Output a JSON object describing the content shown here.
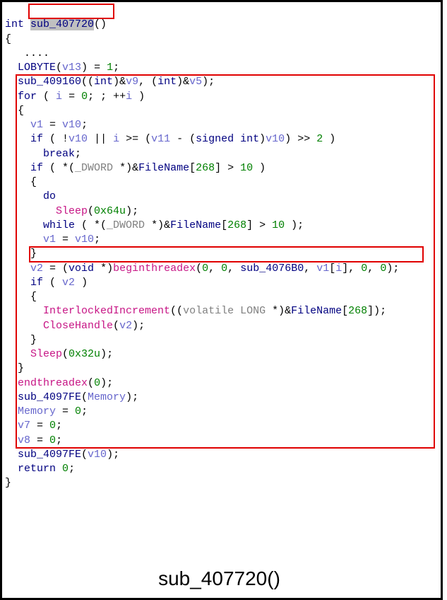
{
  "line1_int": "int",
  "line1_name": "sub_407720",
  "line1_paren": "()",
  "line2": "{",
  "line3_dots": "....",
  "line4_fn": "LOBYTE",
  "line4_v13": "v13",
  "line4_rest": ") = ",
  "line4_one": "1",
  "line4_semi": ";",
  "line5_fn": "sub_409160",
  "line5_int": "int",
  "line5_v9": "v9",
  "line5_v5": "v5",
  "line6_for": "for",
  "line6_i1": "i",
  "line6_zero": "0",
  "line6_i2": "i",
  "line7_brace": "{",
  "line8_v1": "v1",
  "line8_v10": "v10",
  "line9_if": "if",
  "line9_v10": "v10",
  "line9_i": "i",
  "line9_v11": "v11",
  "line9_signed": "signed int",
  "line9_v10b": "v10",
  "line9_two": "2",
  "line10_break": "break",
  "line11_if": "if",
  "line11_dword": "_DWORD",
  "line11_fn": "FileName",
  "line11_268": "268",
  "line11_ten": "10",
  "line12_brace": "{",
  "line13_do": "do",
  "line14_sleep": "Sleep",
  "line14_hex": "0x64u",
  "line15_while": "while",
  "line15_dword": "_DWORD",
  "line15_fn": "FileName",
  "line15_268": "268",
  "line15_ten": "10",
  "line16_v1": "v1",
  "line16_v10": "v10",
  "line17_brace": "}",
  "line18_v2": "v2",
  "line18_void": "void",
  "line18_begin": "beginthreadex",
  "line18_z1": "0",
  "line18_z2": "0",
  "line18_sub": "sub_4076B0",
  "line18_v1": "v1",
  "line18_i": "i",
  "line18_z3": "0",
  "line18_z4": "0",
  "line19_if": "if",
  "line19_v2": "v2",
  "line20_brace": "{",
  "line21_inc": "InterlockedIncrement",
  "line21_vol": "volatile",
  "line21_long": "LONG",
  "line21_fn": "FileName",
  "line21_268": "268",
  "line22_close": "CloseHandle",
  "line22_v2": "v2",
  "line23_brace": "}",
  "line24_sleep": "Sleep",
  "line24_hex": "0x32u",
  "line25_brace": "}",
  "line26_end": "endthreadex",
  "line26_zero": "0",
  "line27_fn": "sub_4097FE",
  "line27_mem": "Memory",
  "line28_mem": "Memory",
  "line28_zero": "0",
  "line29_v7": "v7",
  "line29_zero": "0",
  "line30_v8": "v8",
  "line30_zero": "0",
  "line31_fn": "sub_4097FE",
  "line31_v10": "v10",
  "line32_return": "return",
  "line32_zero": "0",
  "line33": "}",
  "caption": "sub_407720()"
}
